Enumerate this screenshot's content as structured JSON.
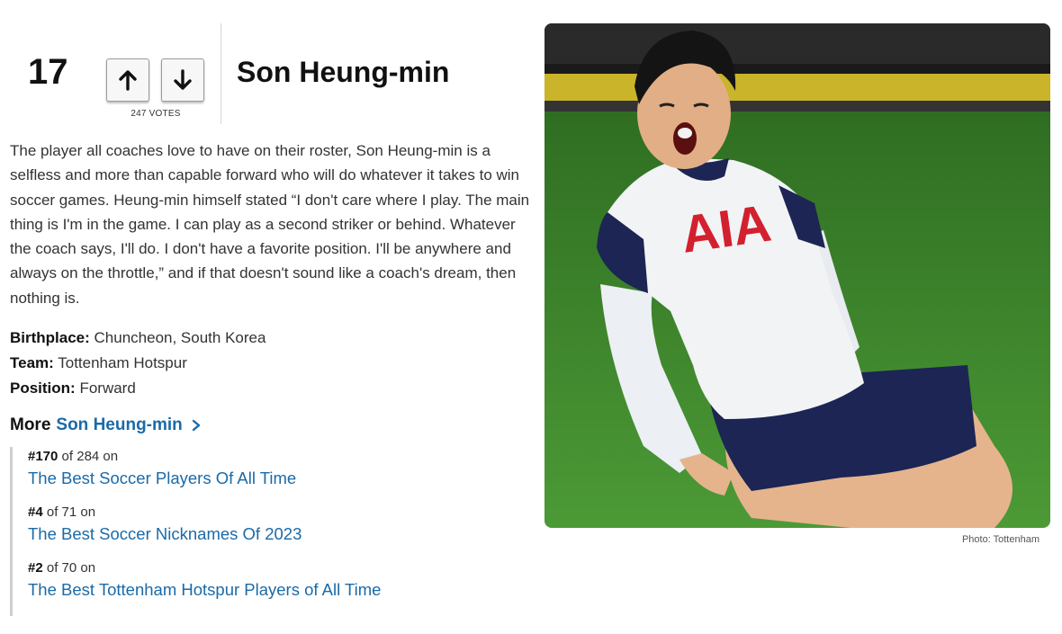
{
  "rank": "17",
  "votes_label": "247 VOTES",
  "player_name": "Son Heung-min",
  "description": "The player all coaches love to have on their roster, Son Heung-min is a selfless and more than capable forward who will do whatever it takes to win soccer games. Heung-min himself stated “I don't care where I play. The main thing is I'm in the game. I can play as a second striker or behind. Whatever the coach says, I'll do. I don't have a favorite position. I'll be anywhere and always on the throttle,” and if that doesn't sound like a coach's dream, then nothing is.",
  "facts": [
    {
      "label": "Birthplace:",
      "value": "Chuncheon, South Korea"
    },
    {
      "label": "Team:",
      "value": "Tottenham Hotspur"
    },
    {
      "label": "Position:",
      "value": "Forward"
    }
  ],
  "more": {
    "prefix": "More",
    "link": "Son Heung-min"
  },
  "rankings": [
    {
      "rank": "#170",
      "of_text": "of 284 on",
      "title": "The Best Soccer Players Of All Time"
    },
    {
      "rank": "#4",
      "of_text": "of 71 on",
      "title": "The Best Soccer Nicknames Of 2023"
    },
    {
      "rank": "#2",
      "of_text": "of 70 on",
      "title": "The Best Tottenham Hotspur Players of All Time"
    }
  ],
  "photo": {
    "jersey_sponsor": "AIA",
    "credit": "Photo: Tottenham"
  },
  "icons": {
    "upvote": "arrow-up-icon",
    "downvote": "arrow-down-icon",
    "more": "chevron-right-icon"
  },
  "colors": {
    "link": "#1a6aa8",
    "pitch": "#3f8a2e",
    "kit_navy": "#1c2553",
    "sponsor_red": "#d3202f"
  }
}
